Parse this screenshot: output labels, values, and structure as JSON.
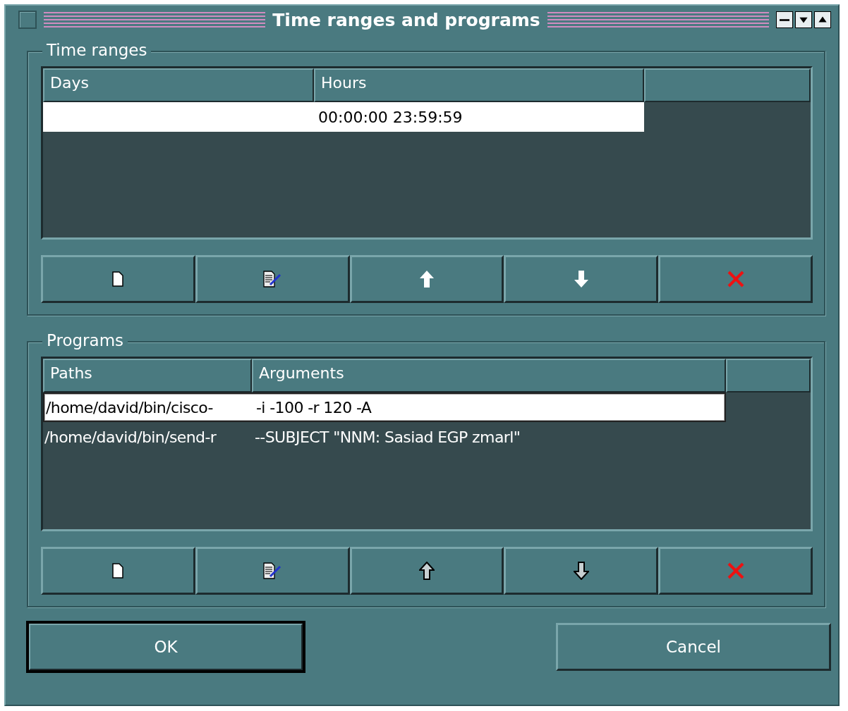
{
  "window": {
    "title": "Time ranges and programs"
  },
  "time_ranges": {
    "title": "Time ranges",
    "columns": [
      "Days",
      "Hours"
    ],
    "rows": [
      {
        "cells": [
          "",
          "00:00:00 23:59:59"
        ],
        "selected": true
      }
    ],
    "buttons": [
      {
        "kind": "new"
      },
      {
        "kind": "edit"
      },
      {
        "kind": "up",
        "disabled": false
      },
      {
        "kind": "down",
        "disabled": false
      },
      {
        "kind": "delete"
      }
    ]
  },
  "programs": {
    "title": "Programs",
    "columns": [
      "Paths",
      "Arguments"
    ],
    "rows": [
      {
        "cells": [
          "/home/david/bin/cisco-",
          "-i -100 -r 120 -A"
        ],
        "selected": true
      },
      {
        "cells": [
          "/home/david/bin/send-r",
          "--SUBJECT \"NNM: Sasiad EGP zmarl\""
        ],
        "selected": false
      }
    ],
    "buttons": [
      {
        "kind": "new"
      },
      {
        "kind": "edit"
      },
      {
        "kind": "up",
        "disabled": true
      },
      {
        "kind": "down",
        "disabled": true
      },
      {
        "kind": "delete"
      }
    ]
  },
  "footer": [
    {
      "label": "OK",
      "default": true
    },
    {
      "label": "Cancel",
      "default": false
    }
  ]
}
